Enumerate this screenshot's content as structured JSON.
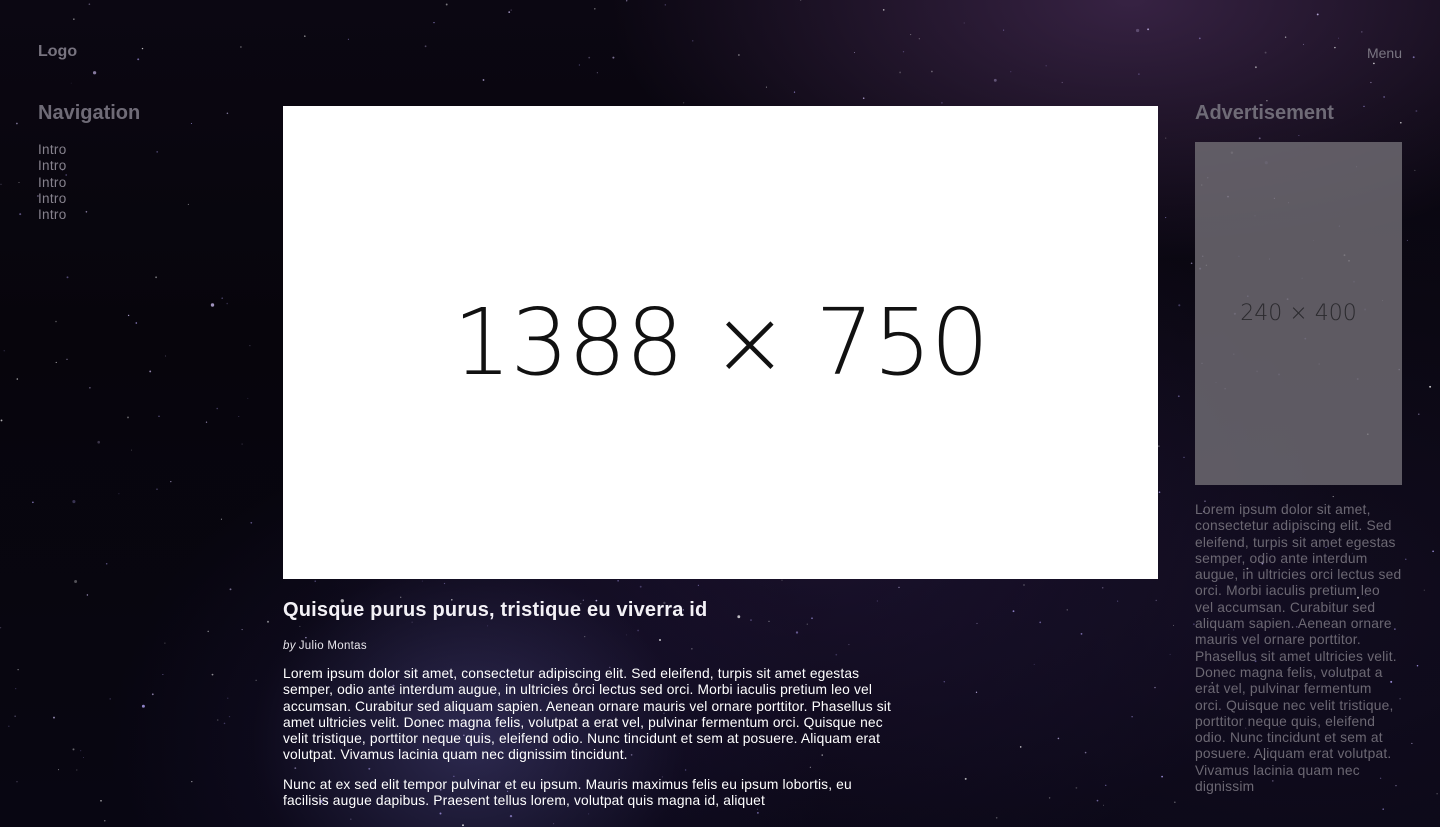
{
  "header": {
    "logo": "Logo",
    "menu_label": "Menu"
  },
  "sidebar": {
    "heading": "Navigation",
    "items": [
      "Intro",
      "Intro",
      "Intro",
      "Intro",
      "Intro"
    ]
  },
  "hero": {
    "placeholder_label": "1388 × 750"
  },
  "article": {
    "title": "Quisque purus purus, tristique eu viverra id",
    "byline_prefix": "by",
    "author": "Julio Montas",
    "paragraphs": [
      "Lorem ipsum dolor sit amet, consectetur adipiscing elit. Sed eleifend, turpis sit amet egestas semper, odio ante interdum augue, in ultricies orci lectus sed orci. Morbi iaculis pretium leo vel accumsan. Curabitur sed aliquam sapien. Aenean ornare mauris vel ornare porttitor. Phasellus sit amet ultricies velit. Donec magna felis, volutpat a erat vel, pulvinar fermentum orci. Quisque nec velit tristique, porttitor neque quis, eleifend odio. Nunc tincidunt et sem at posuere. Aliquam erat volutpat. Vivamus lacinia quam nec dignissim tincidunt.",
      "Nunc at ex sed elit tempor pulvinar et eu ipsum. Mauris maximus felis eu ipsum lobortis, eu facilisis augue dapibus. Praesent tellus lorem, volutpat quis magna id, aliquet"
    ]
  },
  "advertisement": {
    "heading": "Advertisement",
    "placeholder_label": "240 × 400",
    "text": "Lorem ipsum dolor sit amet, consectetur adipiscing elit. Sed eleifend, turpis sit amet egestas semper, odio ante interdum augue, in ultricies orci lectus sed orci. Morbi iaculis pretium leo vel accumsan. Curabitur sed aliquam sapien. Aenean ornare mauris vel ornare porttitor. Phasellus sit amet ultricies velit. Donec magna felis, volutpat a erat vel, pulvinar fermentum orci. Quisque nec velit tristique, porttitor neque quis, eleifend odio. Nunc tincidunt et sem at posuere. Aliquam erat volutpat. Vivamus lacinia quam nec dignissim"
  },
  "colors": {
    "background": "#050308",
    "nebula_purple": "#784b8c",
    "nebula_blue": "#5f5aa5",
    "heading_gray": "#6f6b77",
    "ad_box": "#706c74"
  }
}
